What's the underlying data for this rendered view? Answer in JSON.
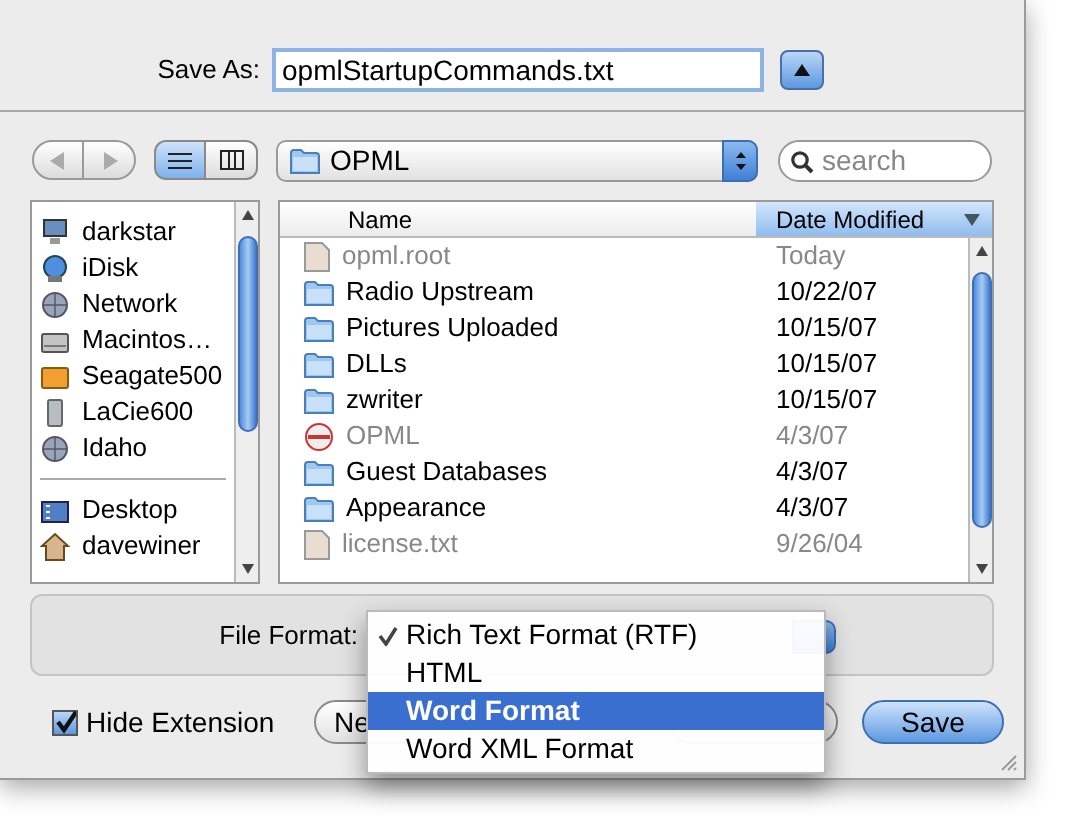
{
  "save_as": {
    "label": "Save As:",
    "value": "opmlStartupCommands.txt",
    "expanded": true
  },
  "navigation": {
    "back_disabled": true,
    "forward_disabled": true
  },
  "view_modes": [
    {
      "kind": "list",
      "selected": true
    },
    {
      "kind": "columns",
      "selected": false
    }
  ],
  "location": {
    "label": "OPML"
  },
  "search": {
    "placeholder": "search"
  },
  "sidebar": {
    "sections": [
      {
        "items": [
          {
            "kind": "computer",
            "label": "darkstar"
          },
          {
            "kind": "idisk",
            "label": "iDisk"
          },
          {
            "kind": "network",
            "label": "Network"
          },
          {
            "kind": "disk",
            "label": "Macintos…"
          },
          {
            "kind": "usb-disk",
            "label": "Seagate500"
          },
          {
            "kind": "external-disk",
            "label": "LaCie600"
          },
          {
            "kind": "network",
            "label": "Idaho"
          }
        ]
      },
      {
        "items": [
          {
            "kind": "desktop",
            "label": "Desktop"
          },
          {
            "kind": "home",
            "label": "davewiner"
          }
        ]
      }
    ]
  },
  "file_list": {
    "columns": [
      {
        "label": "Name",
        "sorted": false
      },
      {
        "label": "Date Modified",
        "sorted": true
      }
    ],
    "rows": [
      {
        "kind": "document",
        "name": "opml.root",
        "date": "Today",
        "dimmed": true
      },
      {
        "kind": "folder",
        "name": "Radio Upstream",
        "date": "10/22/07",
        "dimmed": false
      },
      {
        "kind": "folder",
        "name": "Pictures Uploaded",
        "date": "10/15/07",
        "dimmed": false
      },
      {
        "kind": "folder",
        "name": "DLLs",
        "date": "10/15/07",
        "dimmed": false
      },
      {
        "kind": "folder",
        "name": "zwriter",
        "date": "10/15/07",
        "dimmed": false
      },
      {
        "kind": "application",
        "name": "OPML",
        "date": "4/3/07",
        "dimmed": true
      },
      {
        "kind": "folder",
        "name": "Guest Databases",
        "date": "4/3/07",
        "dimmed": false
      },
      {
        "kind": "folder",
        "name": "Appearance",
        "date": "4/3/07",
        "dimmed": false
      },
      {
        "kind": "document",
        "name": "license.txt",
        "date": "9/26/04",
        "dimmed": true
      }
    ]
  },
  "file_format": {
    "label": "File Format:",
    "menu": [
      {
        "label": "Rich Text Format (RTF)",
        "checked": true,
        "selected": false
      },
      {
        "label": "HTML",
        "checked": false,
        "selected": false
      },
      {
        "label": "Word Format",
        "checked": false,
        "selected": true
      },
      {
        "label": "Word XML Format",
        "checked": false,
        "selected": false
      }
    ]
  },
  "hide_extension": {
    "label": "Hide Extension",
    "checked": true
  },
  "buttons": [
    {
      "kind": "new-folder",
      "label": "Ne"
    },
    {
      "kind": "cancel"
    },
    {
      "kind": "save",
      "label": "Save"
    }
  ]
}
